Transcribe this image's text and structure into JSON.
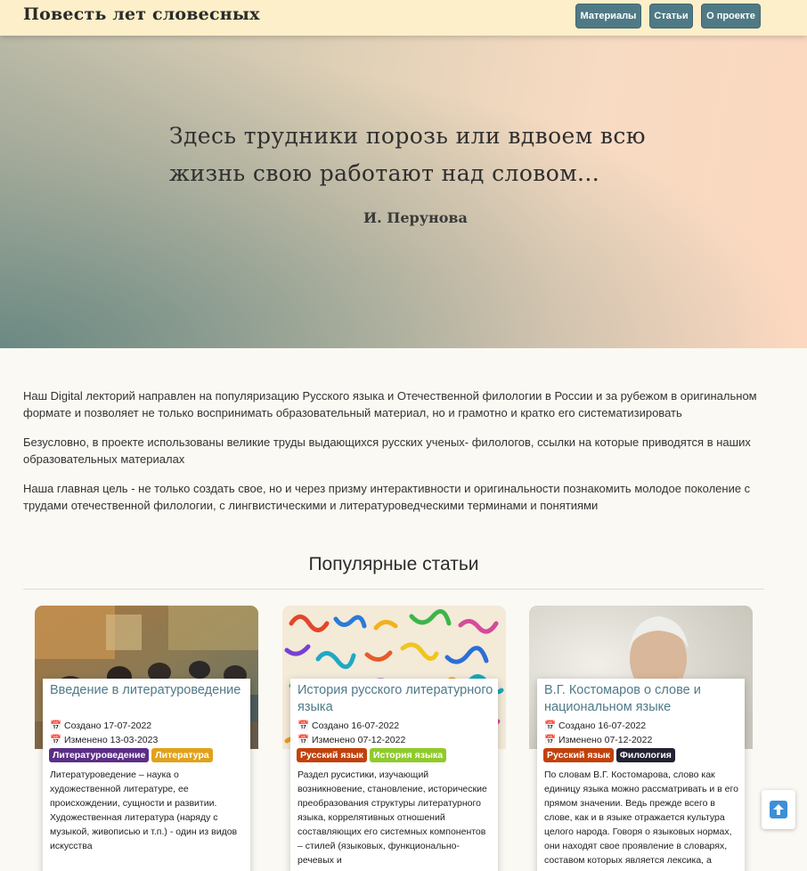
{
  "navbar": {
    "brand": "Повесть лет словесных",
    "links": [
      "Материалы",
      "Статьи",
      "О проекте"
    ]
  },
  "hero": {
    "quote": "Здесь трудники порозь или вдвоем всю жизнь свою работают над словом...",
    "author": "И. Перунова"
  },
  "intro": [
    "Наш Digital лекторий направлен на популяризацию Русского языка и Отечественной филологии в России и за рубежом в оригинальном формате и позволяет не только воспринимать образовательный материал, но и грамотно и кратко его систематизировать",
    "Безусловно, в проекте использованы великие труды выдающихся русских ученых- филологов, ссылки на которые приводятся в наших образовательных материалах",
    "Наша главная цель - не только создать свое, но и через призму интерактивности и оригинальности познакомить молодое поколение с трудами отечественной филологии, с лингвистическими и литературоведческими терминами и понятиями"
  ],
  "popular": {
    "title": "Популярные статьи",
    "cards": [
      {
        "title": "Введение в литературоведение",
        "created": "Создано 17-07-2022",
        "modified": "Изменено 13-03-2023",
        "tags": [
          {
            "label": "Литературоведение",
            "color": "#5b2f86"
          },
          {
            "label": "Литература",
            "color": "#e1a21a"
          }
        ],
        "text": "Литературоведение – наука о художественной литературе, ее происхождении, сущности и развитии. Художественная литература (наряду с музыкой, живописью и т.п.) - один из видов искусства"
      },
      {
        "title": "История русского литературного языка",
        "created": "Создано 16-07-2022",
        "modified": "Изменено 07-12-2022",
        "tags": [
          {
            "label": "Русский язык",
            "color": "#c2410c"
          },
          {
            "label": "История языка",
            "color": "#8fcb2a"
          }
        ],
        "text": "Раздел русистики, изучающий возникновение, становление, исторические преобразования структуры литературного языка, коррелятивных отношений составляющих его системных компонентов – стилей (языковых, функционально-речевых и"
      },
      {
        "title": "В.Г. Костомаров о слове и национальном языке",
        "created": "Создано 16-07-2022",
        "modified": "Изменено 07-12-2022",
        "tags": [
          {
            "label": "Русский язык",
            "color": "#c2410c"
          },
          {
            "label": "Филология",
            "color": "#222233"
          }
        ],
        "text": "По словам В.Г. Костомарова, слово как единицу языка можно рассматривать и в его прямом значении. Ведь прежде всего в слове, как и в языке отражается культура целого народа. Говоря о языковых нормах, они находят свое проявление в словарях, составом которых является лексика, а"
      }
    ]
  },
  "icons": {
    "calendar": "calendar-icon",
    "scroll_top": "arrow-up-icon"
  }
}
